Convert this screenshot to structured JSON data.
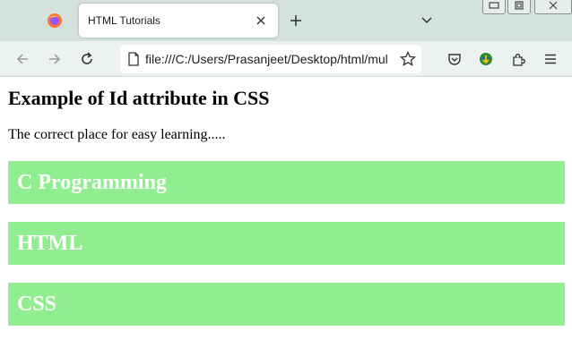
{
  "browser": {
    "tab_title": "HTML Tutorials",
    "url": "file:///C:/Users/Prasanjeet/Desktop/html/mul"
  },
  "colors": {
    "tabbar_bg": "#d3e3db",
    "box_bg": "#90ee90",
    "box_text": "#ffffff"
  },
  "icons": [
    "firefox-logo",
    "close-icon",
    "plus-icon",
    "chevron-down-icon",
    "back-arrow-icon",
    "forward-arrow-icon",
    "reload-icon",
    "page-icon",
    "star-icon",
    "pocket-icon",
    "download-manager-icon",
    "extensions-icon",
    "menu-icon"
  ],
  "page": {
    "heading": "Example of Id attribute in CSS",
    "paragraph": "The correct place for easy learning.....",
    "boxes": [
      "C Programming",
      "HTML",
      "CSS"
    ]
  }
}
